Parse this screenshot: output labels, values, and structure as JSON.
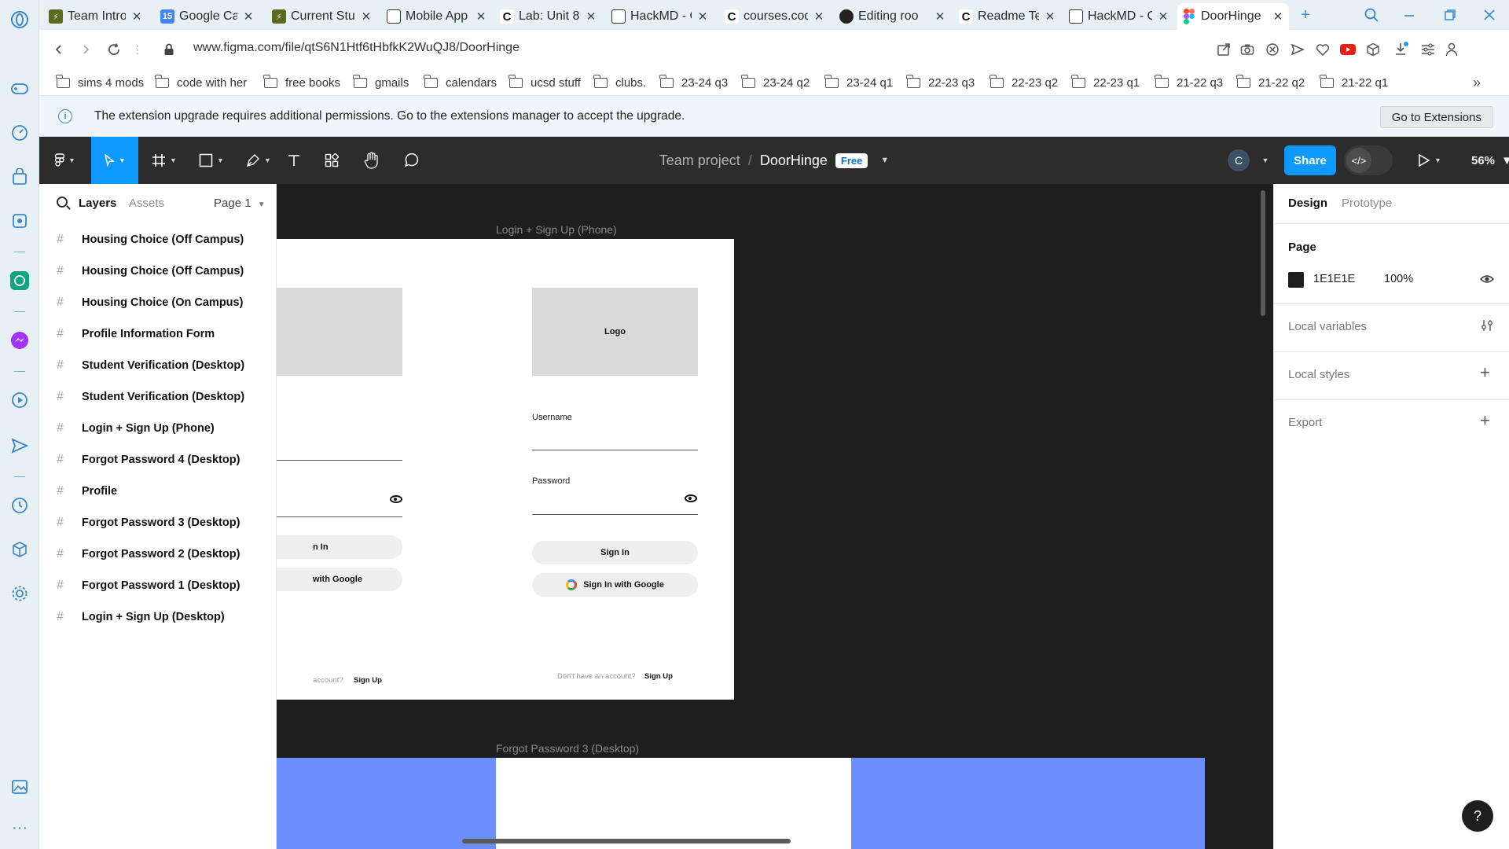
{
  "browser": {
    "tabs": [
      {
        "title": "Team Intro",
        "favicon": "hackmd-icon",
        "color": "#5a6b1f",
        "letter": "",
        "active": false
      },
      {
        "title": "Google Cal",
        "favicon": "google-calendar-icon",
        "color": "#4285f4",
        "letter": "15",
        "active": false
      },
      {
        "title": "Current Stu",
        "favicon": "hackmd-icon",
        "color": "#5a6b1f",
        "letter": "",
        "active": false
      },
      {
        "title": "Mobile App",
        "favicon": "document-icon",
        "color": "#333333",
        "letter": "",
        "active": false
      },
      {
        "title": "Lab: Unit 8",
        "favicon": "coursera-icon",
        "color": "#ffffff",
        "letter": "C",
        "active": false
      },
      {
        "title": "HackMD - C",
        "favicon": "document-icon",
        "color": "#333333",
        "letter": "",
        "active": false
      },
      {
        "title": "courses.cod",
        "favicon": "coursera-icon",
        "color": "#ffffff",
        "letter": "C",
        "active": false
      },
      {
        "title": "Editing roo",
        "favicon": "github-icon",
        "color": "#222222",
        "letter": "",
        "active": false
      },
      {
        "title": "Readme Te",
        "favicon": "coursera-icon",
        "color": "#ffffff",
        "letter": "C",
        "active": false
      },
      {
        "title": "HackMD - C",
        "favicon": "document-icon",
        "color": "#333333",
        "letter": "",
        "active": false
      },
      {
        "title": "DoorHinge",
        "favicon": "figma-icon",
        "color": "#f24e1e",
        "letter": "",
        "active": true
      }
    ],
    "new_tab_symbol": "+",
    "url": "www.figma.com/file/qtS6N1Htf6tHbfkK2WuQJ8/DoorHinge",
    "bookmarks": [
      "sims 4 mods",
      "code with her",
      "free books",
      "gmails",
      "calendars",
      "ucsd stuff",
      "clubs.",
      "23-24 q3",
      "23-24 q2",
      "23-24 q1",
      "22-23 q3",
      "22-23 q2",
      "22-23 q1",
      "21-22 q3",
      "21-22 q2",
      "21-22 q1"
    ],
    "bookmarks_more": "»",
    "info_message": "The extension upgrade requires additional permissions. Go to the extensions manager to accept the upgrade.",
    "info_button": "Go to Extensions"
  },
  "figma": {
    "team": "Team project",
    "separator": "/",
    "file_name": "DoorHinge",
    "plan_badge": "Free",
    "avatar_letter": "C",
    "share_label": "Share",
    "zoom": "56%",
    "left_panel": {
      "tabs": [
        "Layers",
        "Assets"
      ],
      "page": "Page 1",
      "layers": [
        "Housing Choice (Off Campus)",
        "Housing Choice (Off Campus)",
        "Housing Choice (On Campus)",
        "Profile Information Form",
        "Student Verification (Desktop)",
        "Student Verification (Desktop)",
        "Login + Sign Up (Phone)",
        "Forgot Password 4 (Desktop)",
        "Profile",
        "Forgot Password 3 (Desktop)",
        "Forgot Password 2 (Desktop)",
        "Forgot Password 1 (Desktop)",
        "Login + Sign Up (Desktop)"
      ]
    },
    "right_panel": {
      "tabs": [
        "Design",
        "Prototype"
      ],
      "page_section": "Page",
      "page_color_hex": "1E1E1E",
      "page_color": "#1e1e1e",
      "page_opacity": "100%",
      "local_variables": "Local variables",
      "local_styles": "Local styles",
      "export": "Export"
    },
    "canvas": {
      "phone_frame_label": "Login + Sign Up (Phone)",
      "logo": "Logo",
      "partial_logo": "ogo",
      "username_label": "Username",
      "password_label": "Password",
      "sign_in": "Sign In",
      "partial_sign_in": "n In",
      "sign_in_google": "Sign In with Google",
      "partial_google": "with Google",
      "no_account": "Don't have an account?",
      "partial_no_account": "account?",
      "sign_up": "Sign Up",
      "forgot_frame_label": "Forgot Password 3 (Desktop)"
    },
    "help": "?"
  }
}
